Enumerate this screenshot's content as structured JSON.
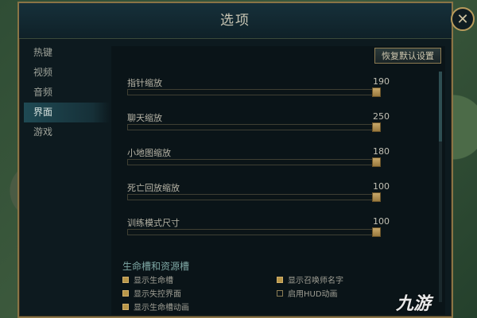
{
  "dialog": {
    "title": "选项",
    "close_glyph": "✕",
    "reset_label": "恢复默认设置"
  },
  "sidebar": {
    "items": [
      {
        "label": "热键",
        "active": false
      },
      {
        "label": "视频",
        "active": false
      },
      {
        "label": "音频",
        "active": false
      },
      {
        "label": "界面",
        "active": true
      },
      {
        "label": "游戏",
        "active": false
      }
    ]
  },
  "sliders": [
    {
      "label": "指针缩放",
      "value": "190",
      "fraction": 1.0
    },
    {
      "label": "聊天缩放",
      "value": "250",
      "fraction": 1.0
    },
    {
      "label": "小地图缩放",
      "value": "180",
      "fraction": 1.0
    },
    {
      "label": "死亡回放缩放",
      "value": "100",
      "fraction": 1.0
    },
    {
      "label": "训练模式尺寸",
      "value": "100",
      "fraction": 1.0
    }
  ],
  "section": {
    "title": "生命槽和资源槽"
  },
  "checkboxes": [
    {
      "label": "显示生命槽",
      "checked": true
    },
    {
      "label": "显示失控界面",
      "checked": true
    },
    {
      "label": "显示生命槽动画",
      "checked": true
    },
    {
      "label": "显示召唤师名字",
      "checked": true
    },
    {
      "label": "启用HUD动画",
      "checked": false
    }
  ],
  "watermark": "九游",
  "colors": {
    "gold": "#b89648",
    "accent_teal": "#7ea7a4",
    "panel": "#0a1418"
  }
}
